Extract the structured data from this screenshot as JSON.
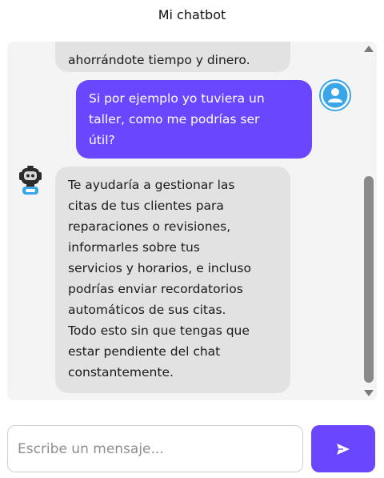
{
  "header": {
    "title": "Mi chatbot"
  },
  "messages": [
    {
      "role": "bot",
      "text": "ahorrándote tiempo y dinero."
    },
    {
      "role": "user",
      "text": "Si por ejemplo yo tuviera un\ntaller, como me podrías ser\nútil?"
    },
    {
      "role": "bot",
      "text": "Te ayudaría a gestionar las\ncitas de tus clientes para\nreparaciones o revisiones,\ninformarles sobre tus\nservicios y horarios, e incluso\npodrías enviar recordatorios\nautomáticos de sus citas.\nTodo esto sin que tengas que\nestar pendiente del chat\nconstantemente."
    }
  ],
  "avatars": {
    "user_icon": "user-avatar-icon",
    "bot_icon": "robot-avatar-icon"
  },
  "composer": {
    "placeholder": "Escribe un mensaje...",
    "value": "",
    "send_icon": "send-icon"
  },
  "colors": {
    "accent": "#6b46ff",
    "bot_bubble": "#e2e2e2",
    "panel_bg": "#f4f4f4",
    "user_avatar": "#3aa6e8"
  }
}
